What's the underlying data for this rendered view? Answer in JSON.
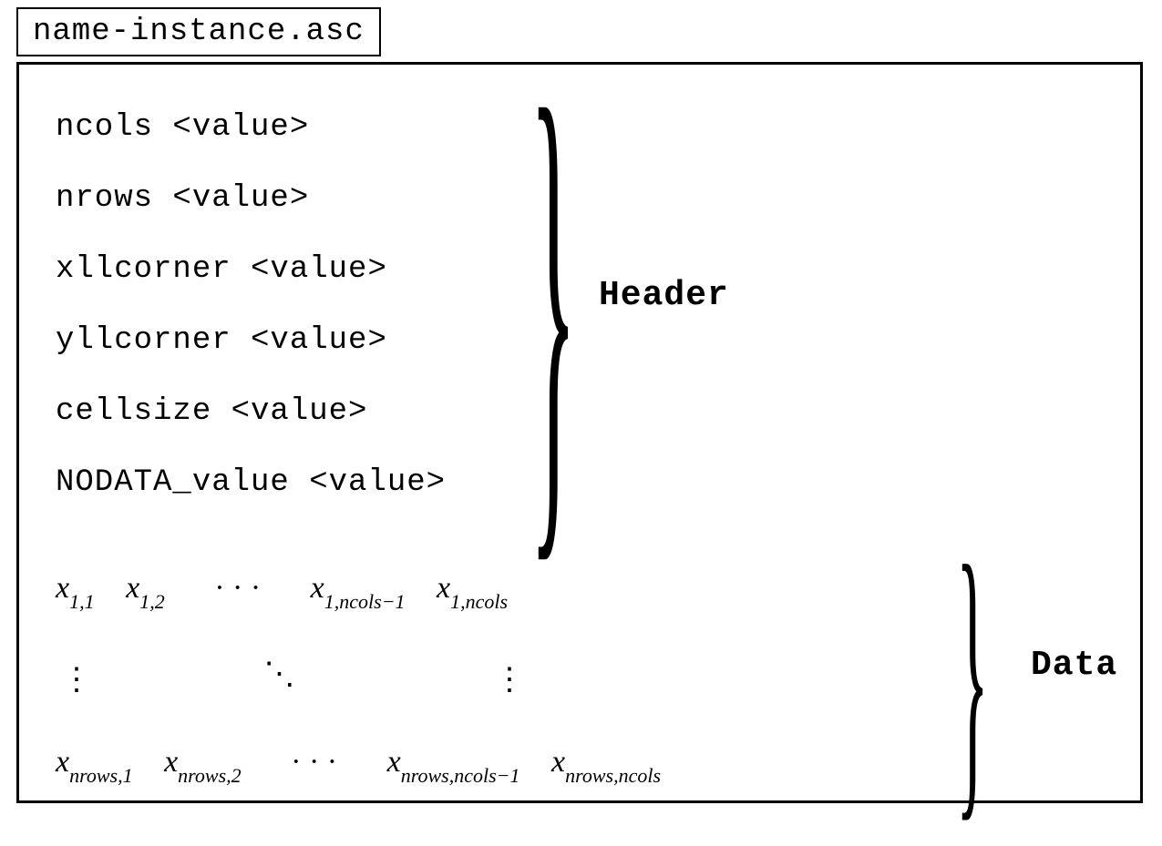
{
  "filename": "name-instance.asc",
  "header_lines": [
    "ncols <value>",
    "nrows <value>",
    "xllcorner <value>",
    "yllcorner <value>",
    "cellsize <value>",
    "NODATA_value <value>"
  ],
  "header_label": "Header",
  "data_label": "Data",
  "row1": {
    "c1": {
      "i": "1",
      "j": "1"
    },
    "c2": {
      "i": "1",
      "j": "2"
    },
    "dots": "· · ·",
    "c3": {
      "i": "1",
      "j": "ncols−1"
    },
    "c4": {
      "i": "1",
      "j": "ncols"
    }
  },
  "vdots": "⋮",
  "ddots": "⋱",
  "rowN": {
    "c1": {
      "i": "nrows",
      "j": "1"
    },
    "c2": {
      "i": "nrows",
      "j": "2"
    },
    "dots": "· · ·",
    "c3": {
      "i": "nrows",
      "j": "ncols−1"
    },
    "c4": {
      "i": "nrows",
      "j": "ncols"
    }
  }
}
